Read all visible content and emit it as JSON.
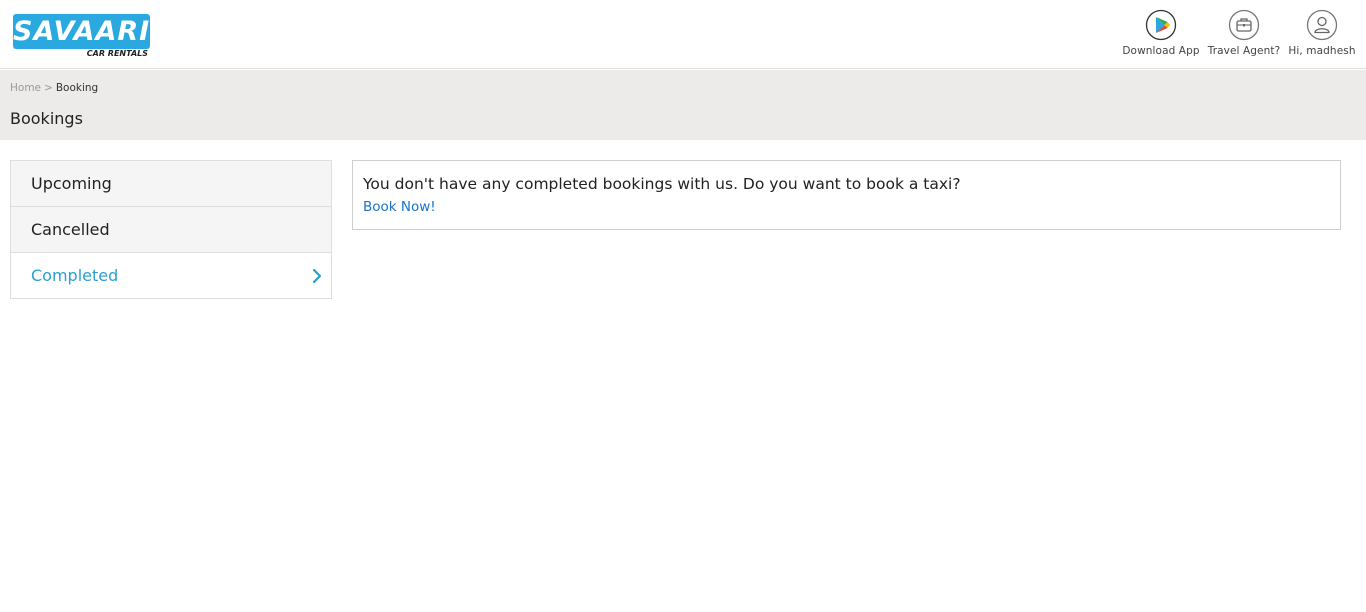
{
  "brand": {
    "name": "SAVAARI",
    "tagline": "CAR RENTALS",
    "color": "#2aa9e0"
  },
  "header": {
    "items": [
      {
        "label": "Download App",
        "icon": "google-play-icon"
      },
      {
        "label": "Travel Agent?",
        "icon": "briefcase-icon"
      },
      {
        "label": "Hi, madhesh",
        "icon": "user-icon"
      }
    ]
  },
  "breadcrumb": {
    "home": "Home",
    "separator": ">",
    "current": "Booking"
  },
  "page": {
    "title": "Bookings"
  },
  "sidebar": {
    "items": [
      {
        "label": "Upcoming",
        "active": false
      },
      {
        "label": "Cancelled",
        "active": false
      },
      {
        "label": "Completed",
        "active": true,
        "icon": "chevron-right-icon"
      }
    ],
    "active_color": "#2aa0cf"
  },
  "content": {
    "message": "You don't have any completed bookings with us. Do you want to book a taxi?",
    "link": "Book Now!",
    "link_color": "#1a73c8"
  }
}
